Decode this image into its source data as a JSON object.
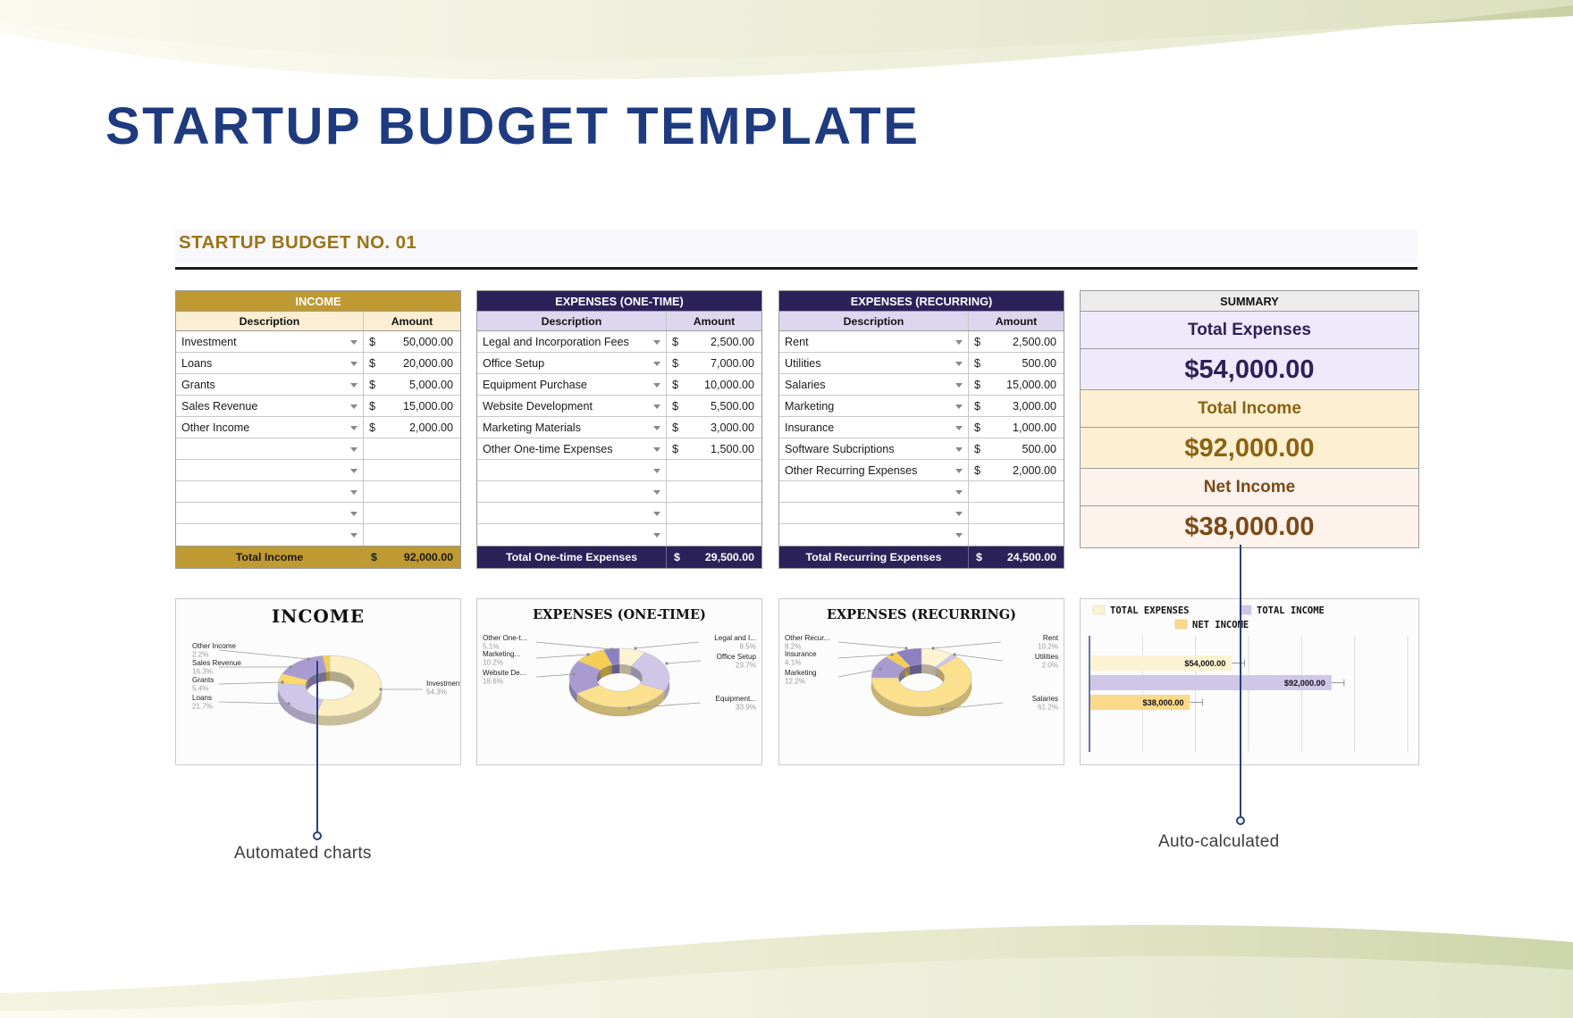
{
  "page": {
    "title": "STARTUP BUDGET TEMPLATE",
    "section_label": "STARTUP BUDGET NO. 01",
    "accent_blue": "#1f3b80",
    "accent_gold": "#bf9a33",
    "accent_navy": "#2b2259"
  },
  "income_table": {
    "title": "INCOME",
    "columns": [
      "Description",
      "Amount"
    ],
    "rows": [
      {
        "desc": "Investment",
        "cur": "$",
        "amt": "50,000.00"
      },
      {
        "desc": "Loans",
        "cur": "$",
        "amt": "20,000.00"
      },
      {
        "desc": "Grants",
        "cur": "$",
        "amt": "5,000.00"
      },
      {
        "desc": "Sales Revenue",
        "cur": "$",
        "amt": "15,000.00"
      },
      {
        "desc": "Other Income",
        "cur": "$",
        "amt": "2,000.00"
      },
      {
        "desc": "",
        "cur": "",
        "amt": ""
      },
      {
        "desc": "",
        "cur": "",
        "amt": ""
      },
      {
        "desc": "",
        "cur": "",
        "amt": ""
      },
      {
        "desc": "",
        "cur": "",
        "amt": ""
      },
      {
        "desc": "",
        "cur": "",
        "amt": ""
      }
    ],
    "total_label": "Total Income",
    "total_cur": "$",
    "total_amt": "92,000.00"
  },
  "onetime_table": {
    "title": "EXPENSES (ONE-TIME)",
    "columns": [
      "Description",
      "Amount"
    ],
    "rows": [
      {
        "desc": "Legal and Incorporation Fees",
        "cur": "$",
        "amt": "2,500.00"
      },
      {
        "desc": "Office Setup",
        "cur": "$",
        "amt": "7,000.00"
      },
      {
        "desc": "Equipment Purchase",
        "cur": "$",
        "amt": "10,000.00"
      },
      {
        "desc": "Website Development",
        "cur": "$",
        "amt": "5,500.00"
      },
      {
        "desc": "Marketing Materials",
        "cur": "$",
        "amt": "3,000.00"
      },
      {
        "desc": "Other One-time Expenses",
        "cur": "$",
        "amt": "1,500.00"
      },
      {
        "desc": "",
        "cur": "",
        "amt": ""
      },
      {
        "desc": "",
        "cur": "",
        "amt": ""
      },
      {
        "desc": "",
        "cur": "",
        "amt": ""
      },
      {
        "desc": "",
        "cur": "",
        "amt": ""
      }
    ],
    "total_label": "Total One-time Expenses",
    "total_cur": "$",
    "total_amt": "29,500.00"
  },
  "recurring_table": {
    "title": "EXPENSES (RECURRING)",
    "columns": [
      "Description",
      "Amount"
    ],
    "rows": [
      {
        "desc": "Rent",
        "cur": "$",
        "amt": "2,500.00"
      },
      {
        "desc": "Utilities",
        "cur": "$",
        "amt": "500.00"
      },
      {
        "desc": "Salaries",
        "cur": "$",
        "amt": "15,000.00"
      },
      {
        "desc": "Marketing",
        "cur": "$",
        "amt": "3,000.00"
      },
      {
        "desc": "Insurance",
        "cur": "$",
        "amt": "1,000.00"
      },
      {
        "desc": "Software Subcriptions",
        "cur": "$",
        "amt": "500.00"
      },
      {
        "desc": "Other Recurring Expenses",
        "cur": "$",
        "amt": "2,000.00"
      },
      {
        "desc": "",
        "cur": "",
        "amt": ""
      },
      {
        "desc": "",
        "cur": "",
        "amt": ""
      },
      {
        "desc": "",
        "cur": "",
        "amt": ""
      }
    ],
    "total_label": "Total Recurring Expenses",
    "total_cur": "$",
    "total_amt": "24,500.00"
  },
  "summary": {
    "title": "SUMMARY",
    "total_expenses_label": "Total Expenses",
    "total_expenses_value": "$54,000.00",
    "total_income_label": "Total Income",
    "total_income_value": "$92,000.00",
    "net_income_label": "Net Income",
    "net_income_value": "$38,000.00"
  },
  "annotations": {
    "automated_charts": "Automated charts",
    "auto_calculated": "Auto-calculated"
  },
  "chart_data": [
    {
      "type": "pie",
      "id": "income-donut",
      "title": "INCOME",
      "labels": [
        "Investment",
        "Loans",
        "Grants",
        "Sales Revenue",
        "Other Income"
      ],
      "values": [
        50000,
        20000,
        5000,
        15000,
        2000
      ],
      "percents": [
        "54.3%",
        "21.7%",
        "5.4%",
        "16.3%",
        "2.2%"
      ],
      "colors": [
        "#fbeec0",
        "#cfc6e8",
        "#fbd96a",
        "#a99bd0",
        "#f5cf55"
      ],
      "legend": "callout-labels",
      "donut": true
    },
    {
      "type": "pie",
      "id": "onetime-donut",
      "title": "EXPENSES (ONE-TIME)",
      "labels": [
        "Legal and I...",
        "Office Setup",
        "Equipment...",
        "Website De...",
        "Marketing...",
        "Other One-t..."
      ],
      "full_labels": [
        "Legal and Incorporation Fees",
        "Office Setup",
        "Equipment Purchase",
        "Website Development",
        "Marketing Materials",
        "Other One-time Expenses"
      ],
      "values": [
        2500,
        7000,
        10000,
        5500,
        3000,
        1500
      ],
      "percents": [
        "8.5%",
        "23.7%",
        "33.9%",
        "18.6%",
        "10.2%",
        "5.1%"
      ],
      "colors": [
        "#fbf3d2",
        "#cfc6e8",
        "#fbe08e",
        "#a99bd0",
        "#f5cf55",
        "#8d7fc0"
      ],
      "legend": "callout-labels",
      "donut": true
    },
    {
      "type": "pie",
      "id": "recurring-donut",
      "title": "EXPENSES (RECURRING)",
      "labels": [
        "Rent",
        "Utilities",
        "Salaries",
        "Marketing",
        "Insurance",
        "Other Recur..."
      ],
      "full_labels": [
        "Rent",
        "Utilities",
        "Salaries",
        "Marketing",
        "Insurance",
        "Other Recurring Expenses"
      ],
      "values": [
        2500,
        500,
        15000,
        3000,
        1000,
        2000
      ],
      "percents": [
        "10.2%",
        "2.0%",
        "61.2%",
        "12.2%",
        "4.1%",
        "8.2%"
      ],
      "colors": [
        "#fbf3d2",
        "#cfc6e8",
        "#fbe08e",
        "#a99bd0",
        "#f5cf55",
        "#8d7fc0"
      ],
      "legend": "callout-labels",
      "donut": true
    },
    {
      "type": "bar",
      "id": "summary-bars",
      "orientation": "horizontal",
      "categories": [
        "TOTAL EXPENSES",
        "TOTAL INCOME",
        "NET INCOME"
      ],
      "values": [
        54000,
        92000,
        38000
      ],
      "data_labels": [
        "$54,000.00",
        "$92,000.00",
        "$38,000.00"
      ],
      "legend_entries": [
        {
          "label": "TOTAL EXPENSES",
          "color": "#fbf3d2"
        },
        {
          "label": "TOTAL INCOME",
          "color": "#cfc6e8"
        },
        {
          "label": "NET INCOME",
          "color": "#fbd98a"
        }
      ],
      "legend_position": "top",
      "grid": true,
      "xlim": [
        0,
        120000
      ]
    }
  ]
}
